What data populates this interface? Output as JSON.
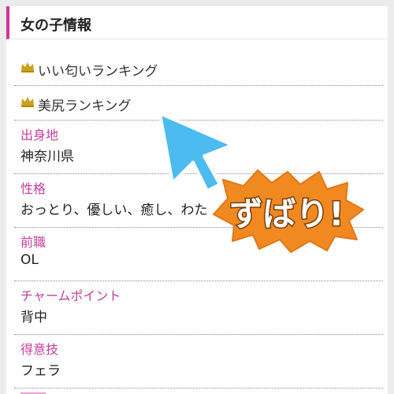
{
  "header": {
    "title": "女の子情報"
  },
  "rankings": [
    {
      "label": "いい匂いランキング"
    },
    {
      "label": "美尻ランキング"
    }
  ],
  "info": [
    {
      "label": "出身地",
      "value": "神奈川県"
    },
    {
      "label": "性格",
      "value": "おっとり、優しい、癒し、わた"
    },
    {
      "label": "前職",
      "value": "OL"
    },
    {
      "label": "チャームポイント",
      "value": "背中"
    },
    {
      "label": "得意技",
      "value": "フェラ"
    }
  ],
  "overlay": {
    "badge_text": "ずばり!"
  },
  "colors": {
    "accent": "#cc3399",
    "label_pink": "#c4409a",
    "arrow_blue": "#4bbbf0",
    "burst_orange": "#f08a20"
  }
}
